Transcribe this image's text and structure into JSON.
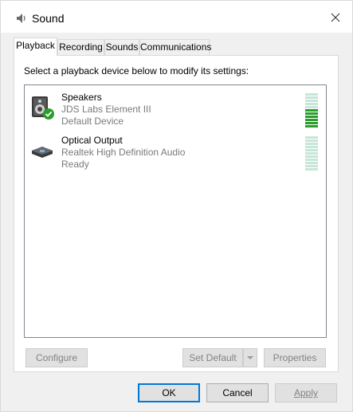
{
  "window": {
    "title": "Sound",
    "icons": {
      "app": "speaker-icon",
      "close": "close-icon"
    }
  },
  "tabs": [
    {
      "label": "Playback",
      "active": true
    },
    {
      "label": "Recording",
      "active": false
    },
    {
      "label": "Sounds",
      "active": false
    },
    {
      "label": "Communications",
      "active": false
    }
  ],
  "playback": {
    "instructions": "Select a playback device below to modify its settings:",
    "devices": [
      {
        "name": "Speakers",
        "description": "JDS Labs Element III",
        "status": "Default Device",
        "icon": "speaker-default-icon",
        "default": true,
        "level_fraction": 0.55
      },
      {
        "name": "Optical Output",
        "description": "Realtek High Definition Audio",
        "status": "Ready",
        "icon": "optical-output-icon",
        "default": false,
        "level_fraction": 0.0
      }
    ],
    "buttons": {
      "configure": "Configure",
      "set_default": "Set Default",
      "properties": "Properties"
    }
  },
  "footer": {
    "ok": "OK",
    "cancel": "Cancel",
    "apply": "Apply"
  },
  "colors": {
    "meter_active": "#2a9d2a",
    "meter_inactive": "#c6e6d8",
    "primary_border": "#0078d7"
  }
}
